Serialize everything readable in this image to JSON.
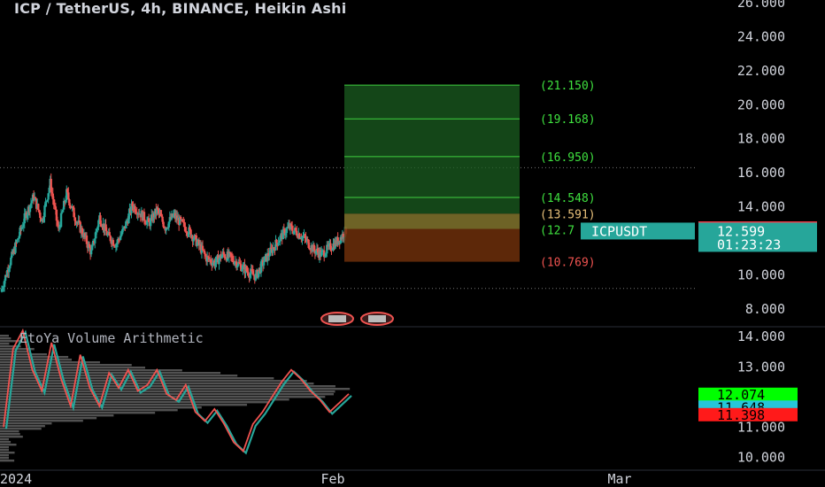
{
  "header": {
    "title": "ICP / TetherUS, 4h, BINANCE, Heikin Ashi"
  },
  "indicator": {
    "title": "EtoYa Volume Arithmetic"
  },
  "colors": {
    "bull": "#26a69a",
    "bear": "#ef5350",
    "target_zone": "#1b5e20",
    "stop_zone": "#6d2f0b",
    "target_text": "#3fe03f",
    "entry_text": "#e8c07a",
    "stop_text": "#ef5350",
    "profile": "#5a5a5a",
    "ma_fast": "#ef5350",
    "ma_slow": "#26a69a"
  },
  "chart_data": [
    {
      "type": "candlestick",
      "title": "ICP / TetherUS, 4h, BINANCE, Heikin Ashi",
      "ylim": [
        7.0,
        26.0
      ],
      "y_ticks": [
        "8.000",
        "10.000",
        "12.000",
        "14.000",
        "16.000",
        "18.000",
        "20.000",
        "22.000",
        "24.000",
        "26.000"
      ],
      "dotted_levels": [
        16.3,
        9.2
      ],
      "series_close": [
        9.0,
        10.6,
        12.0,
        13.5,
        14.6,
        13.2,
        15.4,
        12.6,
        14.8,
        13.4,
        12.4,
        11.3,
        13.4,
        12.3,
        11.8,
        12.7,
        14.1,
        13.6,
        13.0,
        13.8,
        12.8,
        13.5,
        13.0,
        12.5,
        11.8,
        11.0,
        10.7,
        11.2,
        11.0,
        10.6,
        10.2,
        9.9,
        10.8,
        11.5,
        12.2,
        12.8,
        12.5,
        12.1,
        11.5,
        11.2,
        11.6,
        12.0,
        12.6
      ],
      "last_price": "12.599",
      "high_label": "12.674",
      "symbol": "ICPUSDT",
      "countdown": "01:23:23",
      "position": {
        "entry": 13.591,
        "stop": 10.769,
        "targets": [
          21.15,
          19.168,
          16.95,
          14.548
        ],
        "entry_label": "(13.591)",
        "stop_label": "(10.769)",
        "target_labels": [
          "(21.150)",
          "(19.168)",
          "(16.950)",
          "(14.548)"
        ],
        "partial_label": "(12.7",
        "partial_value": 12.7
      }
    },
    {
      "type": "line",
      "title": "EtoYa Volume Arithmetic",
      "ylim": [
        9.6,
        14.3
      ],
      "y_ticks": [
        "10.000",
        "11.000",
        "12.000",
        "13.000",
        "14.000"
      ],
      "series": [
        {
          "values": [
            11.0,
            13.6,
            14.2,
            12.9,
            12.2,
            13.8,
            12.6,
            11.7,
            13.4,
            12.3,
            11.7,
            12.8,
            12.3,
            12.9,
            12.2,
            12.4,
            12.9,
            12.1,
            11.9,
            12.4,
            11.5,
            11.2,
            11.6,
            11.1,
            10.5,
            10.2,
            11.1,
            11.5,
            12.0,
            12.5,
            12.9,
            12.6,
            12.2,
            11.9,
            11.5,
            11.8,
            12.1
          ]
        }
      ],
      "x_ticks": [
        "2024",
        "Feb",
        "Mar"
      ],
      "markers": [
        "12.074",
        "11.648",
        "11.398"
      ]
    }
  ]
}
